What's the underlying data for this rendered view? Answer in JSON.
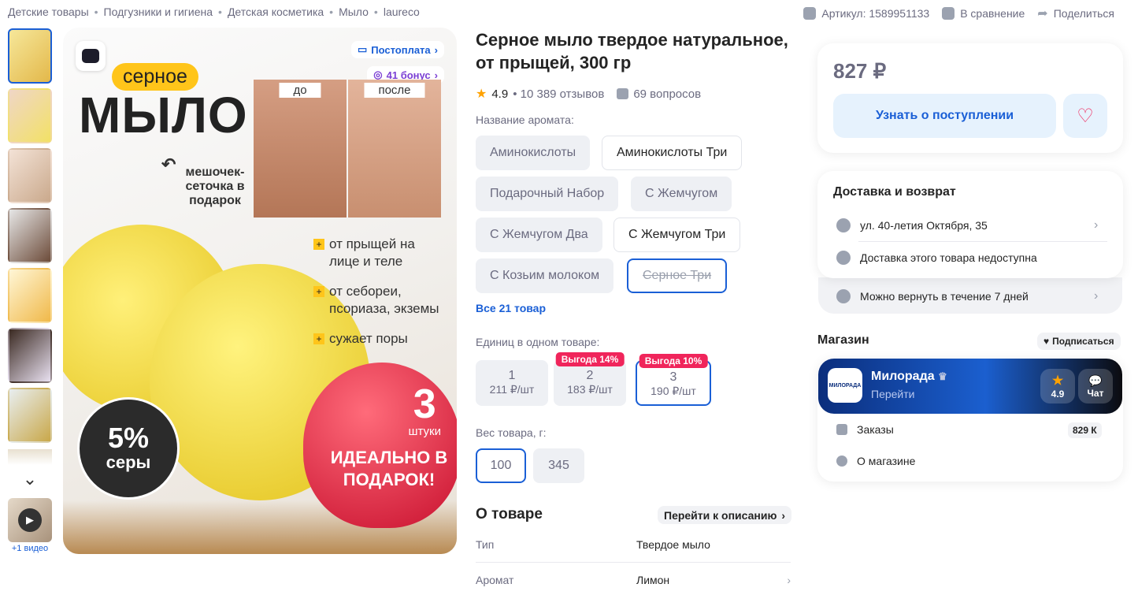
{
  "breadcrumbs": [
    "Детские товары",
    "Подгузники и гигиена",
    "Детская косметика",
    "Мыло",
    "laureco"
  ],
  "top_actions": {
    "article": "Артикул: 1589951133",
    "compare": "В сравнение",
    "share": "Поделиться"
  },
  "gallery": {
    "video_label": "+1 видео"
  },
  "hero": {
    "postpay": "Постоплата",
    "bonus": "41 бонус",
    "badge": "серное",
    "headline": "мыло",
    "before": "до",
    "after": "после",
    "gift_bag": "мешочек-сеточка в подарок",
    "bullets": [
      "от прыщей на лице и теле",
      "от себореи, псориаза, экземы",
      "сужает поры"
    ],
    "count_number": "3",
    "count_label": "штуки",
    "gift_text": "ИДЕАЛЬНО В ПОДАРОК!",
    "seal_percent": "5%",
    "seal_label": "серы"
  },
  "product": {
    "title": "Серное мыло твердое натуральное, от прыщей, 300 гр",
    "rating": "4.9",
    "reviews": "• 10 389 отзывов",
    "questions": "69 вопросов",
    "aroma_label": "Название аромата:",
    "aromas": [
      "Аминокислоты",
      "Аминокислоты Три",
      "Подарочный Набор",
      "С Жемчугом",
      "С Жемчугом Два",
      "С Жемчугом Три",
      "С Козьим молоком",
      "Серное Три"
    ],
    "all_link": "Все 21 товар",
    "units_label": "Единиц в одном товаре:",
    "units": [
      {
        "n": "1",
        "price": "211 ₽/шт",
        "tag": ""
      },
      {
        "n": "2",
        "price": "183 ₽/шт",
        "tag": "Выгода 14%"
      },
      {
        "n": "3",
        "price": "190 ₽/шт",
        "tag": "Выгода 10%"
      }
    ],
    "weight_label": "Вес товара, г:",
    "weights": [
      "100",
      "345"
    ],
    "about_title": "О товаре",
    "to_description": "Перейти к описанию",
    "props": [
      {
        "k": "Тип",
        "v": "Твердое мыло"
      },
      {
        "k": "Аромат",
        "v": "Лимон"
      }
    ]
  },
  "buy": {
    "price": "827 ₽",
    "notify": "Узнать о поступлении"
  },
  "delivery": {
    "title": "Доставка и возврат",
    "address": "ул. 40-летия Октября, 35",
    "unavailable": "Доставка этого товара недоступна",
    "return": "Можно вернуть в течение 7 дней"
  },
  "shop": {
    "title": "Магазин",
    "subscribe": "Подписаться",
    "name": "Милорада",
    "go": "Перейти",
    "logo_text": "МИЛОРАДА",
    "rating": "4.9",
    "chat": "Чат",
    "orders_label": "Заказы",
    "orders_count": "829 К",
    "about": "О магазине"
  },
  "colors": {
    "accent": "#1a5fd6",
    "sale": "#f0255b",
    "star": "#ffa200"
  }
}
